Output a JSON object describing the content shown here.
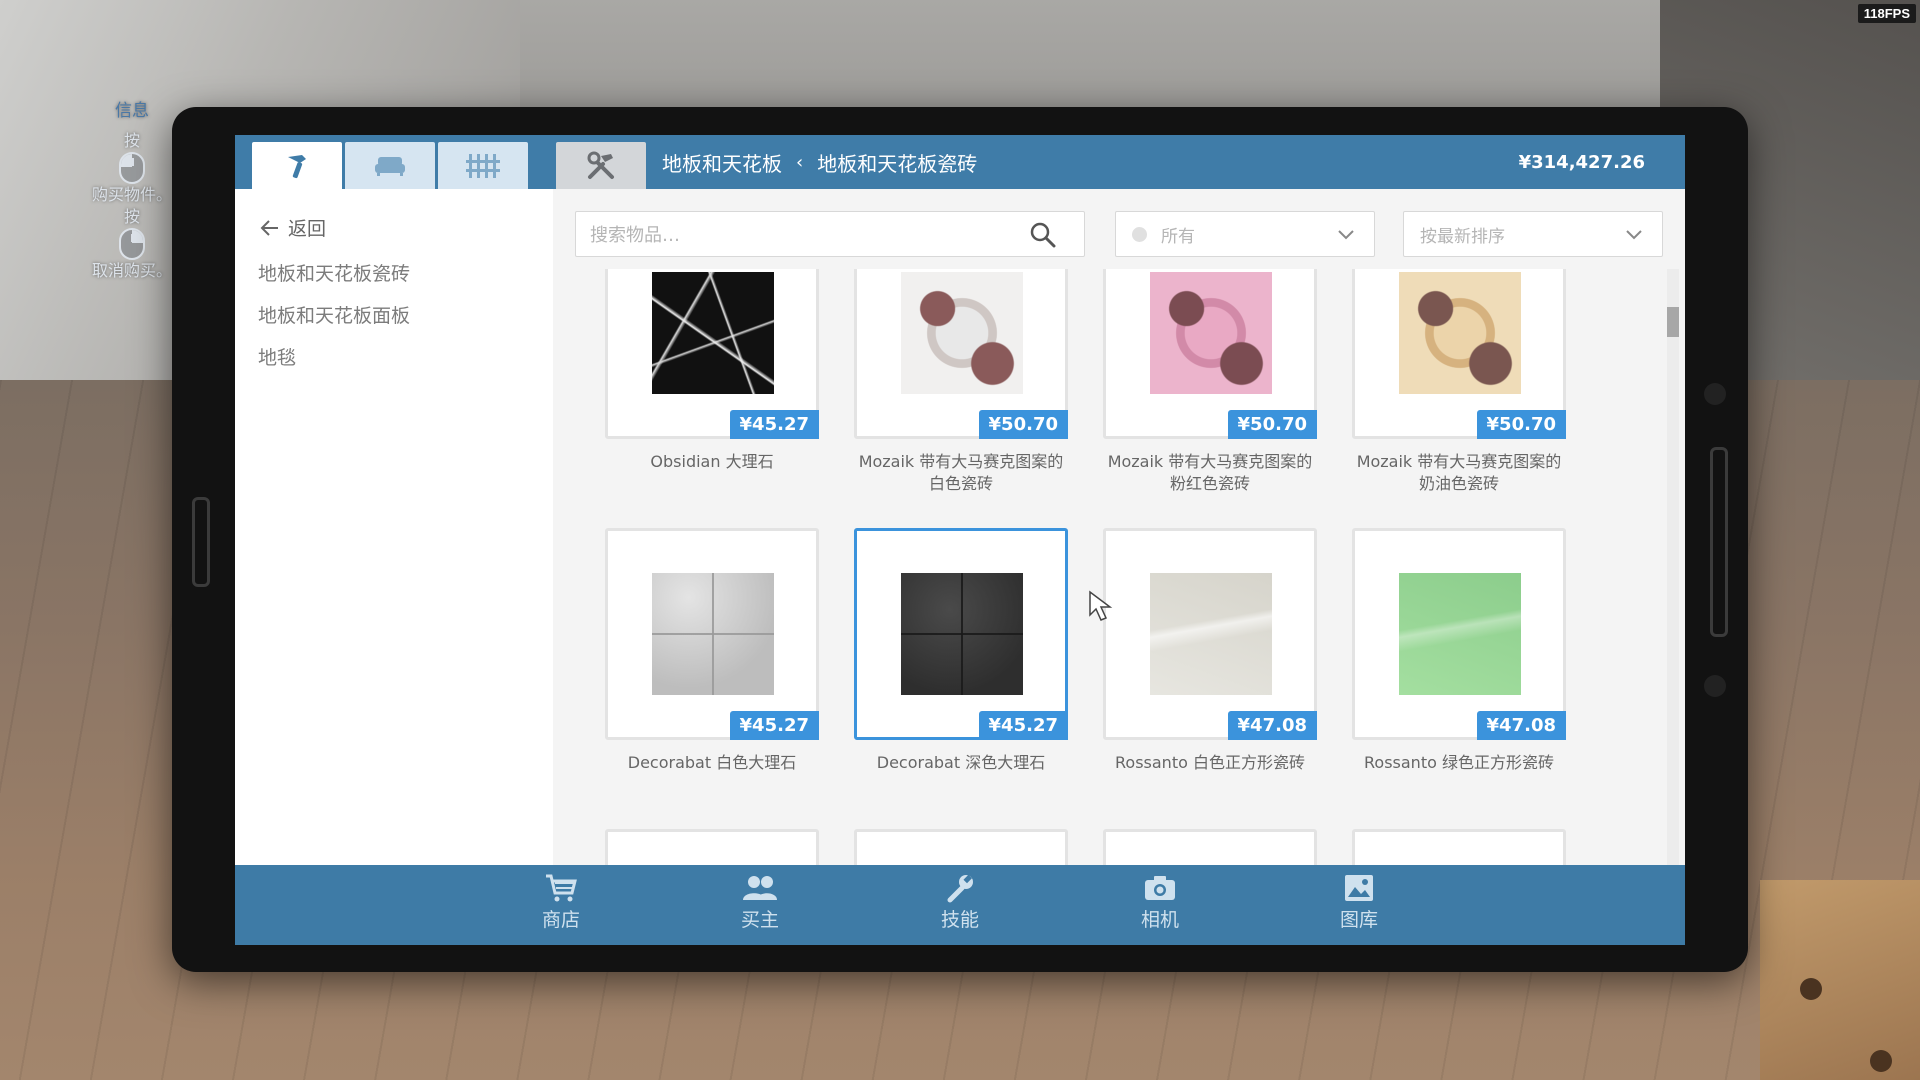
{
  "hud": {
    "fps": "118FPS",
    "hints": {
      "title": "信息",
      "press1": "按",
      "buy": "购买物件。",
      "press2": "按",
      "cancel": "取消购买。"
    }
  },
  "topbar": {
    "tabs": [
      {
        "icon": "hammer-icon",
        "active": true
      },
      {
        "icon": "sofa-icon",
        "active": false
      },
      {
        "icon": "fence-icon",
        "active": false
      },
      {
        "icon": "tools-icon",
        "active": false
      }
    ],
    "breadcrumb": {
      "parent": "地板和天花板",
      "separator": "‹",
      "current": "地板和天花板瓷砖"
    },
    "money": "¥314,427.26"
  },
  "sidenav": {
    "back_label": "返回",
    "categories": [
      "地板和天花板瓷砖",
      "地板和天花板面板",
      "地毯"
    ]
  },
  "toolbar": {
    "search_placeholder": "搜索物品…",
    "filter_value": "所有",
    "sort_value": "按最新排序"
  },
  "items": [
    {
      "name": "Obsidian 大理石",
      "price": "¥45.27",
      "texture": "obsidian",
      "selected": false
    },
    {
      "name": "Mozaik 带有大马赛克图案的白色瓷砖",
      "price": "¥50.70",
      "texture": "moz-white",
      "selected": false
    },
    {
      "name": "Mozaik 带有大马赛克图案的粉红色瓷砖",
      "price": "¥50.70",
      "texture": "moz-pink",
      "selected": false
    },
    {
      "name": "Mozaik 带有大马赛克图案的奶油色瓷砖",
      "price": "¥50.70",
      "texture": "moz-cream",
      "selected": false
    },
    {
      "name": "Decorabat 白色大理石",
      "price": "¥45.27",
      "texture": "marble-white",
      "selected": false
    },
    {
      "name": "Decorabat 深色大理石",
      "price": "¥45.27",
      "texture": "marble-dark",
      "selected": true
    },
    {
      "name": "Rossanto 白色正方形瓷砖",
      "price": "¥47.08",
      "texture": "rossanto-white",
      "selected": false
    },
    {
      "name": "Rossanto 绿色正方形瓷砖",
      "price": "¥47.08",
      "texture": "rossanto-green",
      "selected": false
    }
  ],
  "bottomnav": [
    {
      "label": "商店",
      "icon": "cart-icon"
    },
    {
      "label": "买主",
      "icon": "people-icon"
    },
    {
      "label": "技能",
      "icon": "wrench-icon"
    },
    {
      "label": "相机",
      "icon": "camera-icon"
    },
    {
      "label": "图库",
      "icon": "image-icon"
    }
  ],
  "colors": {
    "topbar": "#3f7ca8",
    "accent": "#3b93dc",
    "bottombar": "#3e7ba6"
  }
}
